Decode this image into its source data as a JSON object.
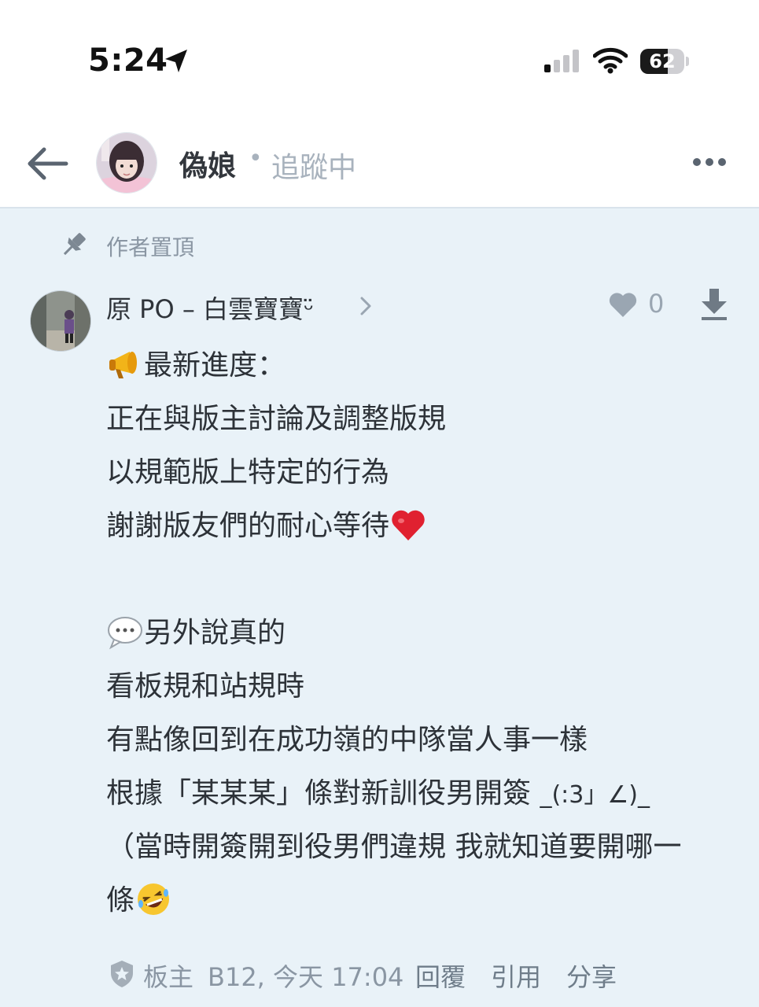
{
  "status_bar": {
    "time": "5:24",
    "battery_level": "62",
    "battery_fraction": 0.62
  },
  "header": {
    "title": "偽娘",
    "separator": "•",
    "follow_status": "追蹤中"
  },
  "post": {
    "pin_label": "作者置頂",
    "author": "原 PO – 白雲寶寶",
    "author_decoration": "ᵕ̈",
    "like_count": "0",
    "lines": [
      "最新進度：",
      "正在與版主討論及調整版規",
      "以規範版上特定的行為",
      "謝謝版友們的耐心等待",
      "",
      "另外說真的",
      "看板規和站規時",
      "有點像回到在成功嶺的中隊當人事一樣",
      "根據「某某某」條對新訓役男開簽",
      "（當時開簽開到役男們違規 我就知道要開哪一",
      "條"
    ],
    "shrug": "_(:3」∠)_",
    "footer": {
      "role": "板主",
      "floor_time": "B12, 今天 17:04",
      "reply": "回覆",
      "quote": "引用",
      "share": "分享"
    }
  },
  "icons": {
    "location": "location-arrow-icon",
    "signal": "cellular-signal-icon",
    "wifi": "wifi-icon",
    "back": "back-arrow-icon",
    "more": "more-dots-icon",
    "pin": "pin-icon",
    "chevron": "chevron-right-icon",
    "heart": "heart-icon",
    "download": "download-arrow-icon",
    "megaphone": "megaphone-icon",
    "heart_emoji": "red-heart-icon",
    "speech": "speech-bubble-icon",
    "laugh": "rolling-laugh-icon",
    "shield": "shield-icon"
  },
  "colors": {
    "post_background": "#e9f2f8",
    "muted_text": "#8a96a3",
    "heart_red": "#e02130"
  }
}
